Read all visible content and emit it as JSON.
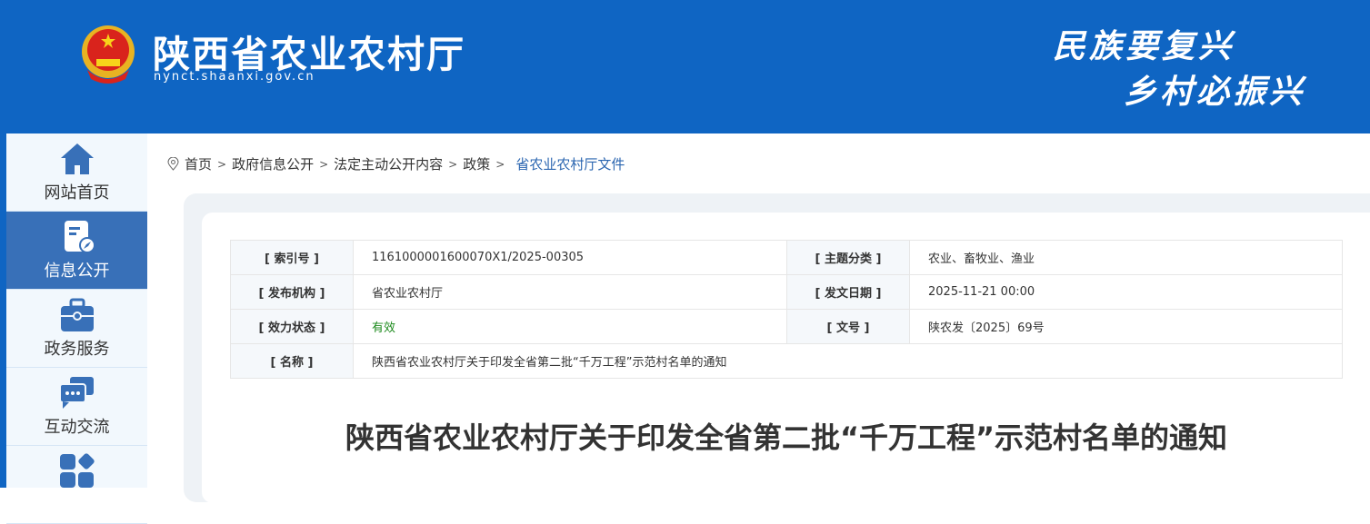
{
  "header": {
    "title": "陕西省农业农村厅",
    "url": "nynct.shaanxi.gov.cn",
    "slogan_line1": "民族要复兴",
    "slogan_line2": "乡村必振兴"
  },
  "sidebar": {
    "items": [
      {
        "label": "网站首页",
        "icon": "home-icon"
      },
      {
        "label": "信息公开",
        "icon": "document-compass-icon",
        "active": true
      },
      {
        "label": "政务服务",
        "icon": "briefcase-icon"
      },
      {
        "label": "互动交流",
        "icon": "chat-icon"
      },
      {
        "label": "",
        "icon": "apps-icon"
      }
    ]
  },
  "breadcrumb": {
    "items": [
      "首页",
      "政府信息公开",
      "法定主动公开内容",
      "政策"
    ],
    "current": "省农业农村厅文件",
    "separator": ">"
  },
  "meta": {
    "index_label": "[ 索引号 ]",
    "index_value": "1161000001600070X1/2025-00305",
    "topic_label": "[ 主题分类 ]",
    "topic_value": "农业、畜牧业、渔业",
    "issuer_label": "[ 发布机构 ]",
    "issuer_value": "省农业农村厅",
    "date_label": "[ 发文日期 ]",
    "date_value": "2025-11-21 00:00",
    "status_label": "[ 效力状态 ]",
    "status_value": "有效",
    "docno_label": "[ 文号 ]",
    "docno_value": "陕农发〔2025〕69号",
    "name_label": "[ 名称 ]",
    "name_value": "陕西省农业农村厅关于印发全省第二批“千万工程”示范村名单的通知"
  },
  "document": {
    "title": "陕西省农业农村厅关于印发全省第二批“千万工程”示范村名单的通知"
  },
  "colors": {
    "brand": "#0f65c3",
    "nav_active": "#3870b8",
    "status_valid": "#1c8a1c"
  }
}
